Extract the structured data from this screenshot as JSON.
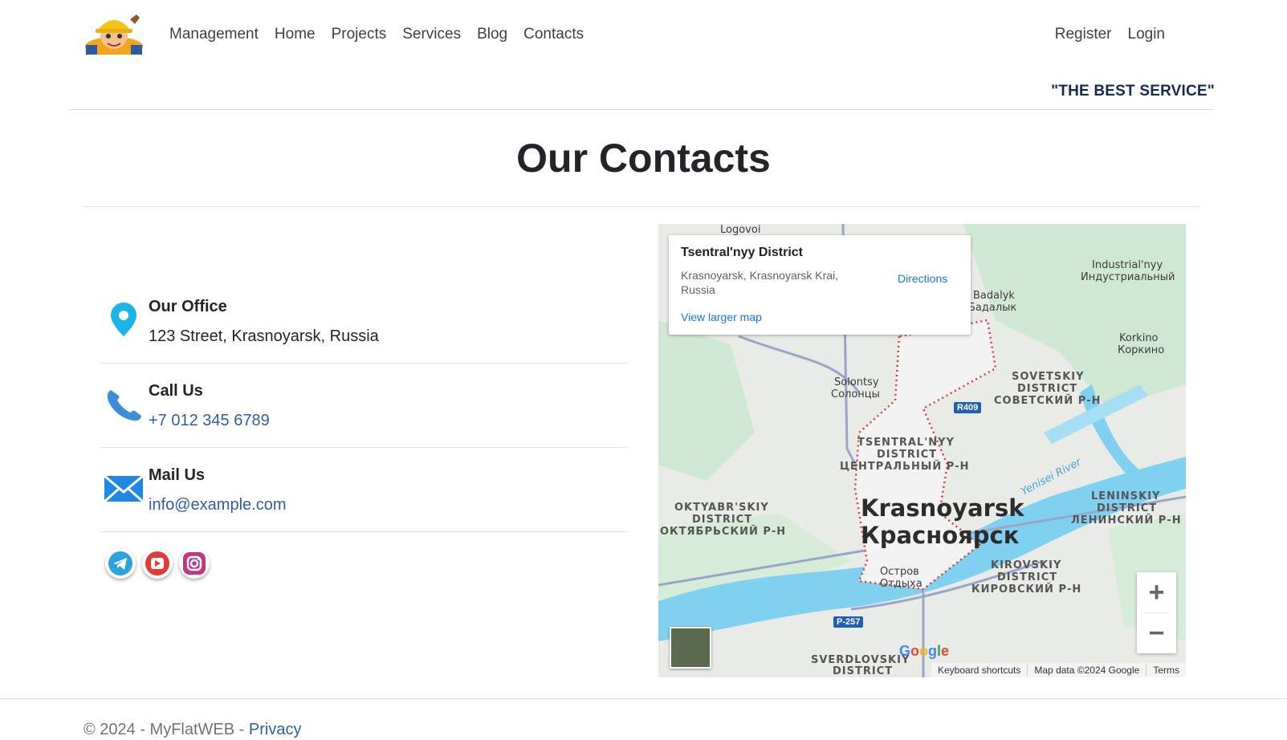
{
  "header": {
    "logo_icon": "builder-mascot-icon",
    "nav_left": [
      "Management",
      "Home",
      "Projects",
      "Services",
      "Blog",
      "Contacts"
    ],
    "nav_right": [
      "Register",
      "Login"
    ],
    "tagline": "\"THE BEST SERVICE\""
  },
  "page": {
    "title": "Our Contacts"
  },
  "contacts": {
    "office": {
      "icon": "map-pin-icon",
      "heading": "Our Office",
      "value": "123 Street, Krasnoyarsk, Russia"
    },
    "call": {
      "icon": "phone-icon",
      "heading": "Call Us",
      "value": "+7 012 345 6789"
    },
    "mail": {
      "icon": "envelope-icon",
      "heading": "Mail Us",
      "value": "info@example.com"
    }
  },
  "social": [
    "telegram-icon",
    "youtube-icon",
    "instagram-icon"
  ],
  "map": {
    "card": {
      "name": "Tsentral'nyy District",
      "address": "Krasnoyarsk, Krasnoyarsk Krai, Russia",
      "directions": "Directions",
      "larger": "View larger map"
    },
    "labels": {
      "logovoi": "Logovoi",
      "industrial_en": "Industrial'nyy",
      "industrial_ru": "Индустриальный",
      "badalyk_en": "Badalyk",
      "badalyk_ru": "Бадалык",
      "korkino_en": "Korkino",
      "korkino_ru": "Коркино",
      "solontsy_en": "Solontsy",
      "solontsy_ru": "Солонцы",
      "sovetskiy_1": "SOVETSKIY",
      "sovetskiy_2": "DISTRICT",
      "sovetskiy_ru": "СОВЕТСКИЙ Р-Н",
      "tsentral_1": "TSENTRAL'NYY",
      "tsentral_2": "DISTRICT",
      "tsentral_ru": "ЦЕНТРАЛЬНЫЙ Р-Н",
      "oktyabr_1": "OKTYABR'SKIY",
      "oktyabr_2": "DISTRICT",
      "oktyabr_ru": "ОКТЯБРЬСКИЙ Р-Н",
      "city_en": "Krasnoyarsk",
      "city_ru": "Красноярск",
      "leninskiy_1": "LENINSKIY",
      "leninskiy_2": "DISTRICT",
      "leninskiy_ru": "ЛЕНИНСКИЙ Р-Н",
      "ostrov_1": "Остров",
      "ostrov_2": "Отдыха",
      "kirovskiy_1": "KIROVSKIY",
      "kirovskiy_2": "DISTRICT",
      "kirovskiy_ru": "КИРОВСКИЙ Р-Н",
      "sverdlovskiy_1": "SVERDLOVSKIY",
      "sverdlovskiy_2": "DISTRICT",
      "river": "Yenisei River",
      "r409": "R409",
      "p257": "P-257"
    },
    "zoom_in": "+",
    "zoom_out": "−",
    "google": "Google",
    "attribution": [
      "Keyboard shortcuts",
      "Map data ©2024 Google",
      "Terms"
    ]
  },
  "footer": {
    "text": "© 2024 - MyFlatWEB - ",
    "privacy": "Privacy"
  }
}
